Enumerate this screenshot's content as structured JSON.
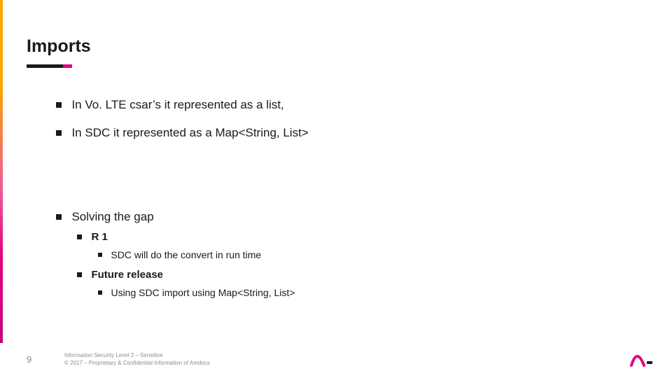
{
  "title": "Imports",
  "bullets": {
    "b1": "In Vo. LTE csar’s it represented as a list,",
    "b2": "In SDC it represented as a Map<String, List>",
    "b3": "Solving the gap",
    "b3_1": "R 1",
    "b3_1_1": "SDC will do the convert in run time",
    "b3_2": "Future release",
    "b3_2_1": "Using SDC import using Map<String, List>"
  },
  "footer": {
    "page": "9",
    "line1": "Information Security Level 2 – Sensitive",
    "line2": "© 2017 – Proprietary & Confidential Information of Amdocs"
  }
}
